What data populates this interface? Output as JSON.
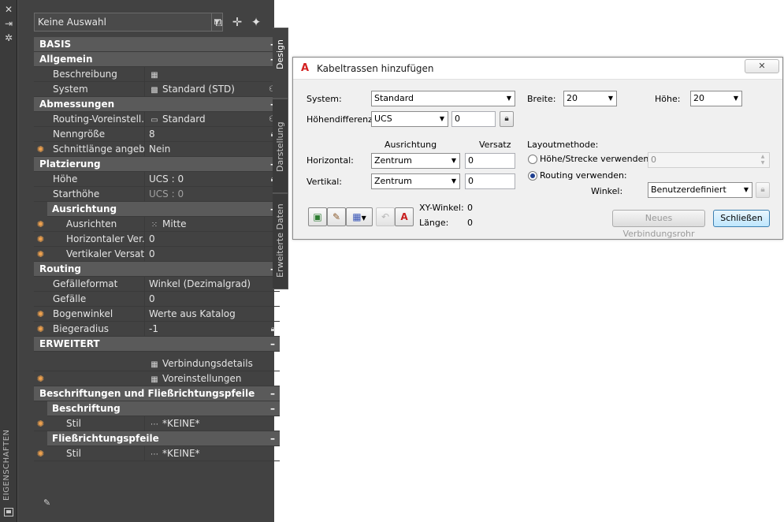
{
  "palette": {
    "title": "EIGENSCHAFTEN",
    "selection": "Keine Auswahl",
    "tabs": [
      "Design",
      "Darstellung",
      "Erweiterte Daten"
    ],
    "sections": [
      {
        "label": "BASIS",
        "toggle": "–"
      },
      {
        "label": "Allgemein",
        "toggle": "–"
      },
      {
        "label": "Abmessungen",
        "toggle": "–"
      },
      {
        "label": "Platzierung",
        "toggle": "–"
      },
      {
        "label": "Ausrichtung",
        "toggle": "–"
      },
      {
        "label": "Routing",
        "toggle": "–"
      },
      {
        "label": "ERWEITERT",
        "toggle": "–"
      },
      {
        "label": "Beschriftungen und Fließrichtungspfeile",
        "toggle": "–"
      },
      {
        "label": "Beschriftung",
        "toggle": "–"
      },
      {
        "label": "Fließrichtungspfeile",
        "toggle": "–"
      }
    ],
    "rows": [
      {
        "name": "Beschreibung",
        "value": ""
      },
      {
        "name": "System",
        "value": "Standard (STD)"
      },
      {
        "name": "Routing-Voreinstell...",
        "value": "Standard"
      },
      {
        "name": "Nenngröße",
        "value": "8"
      },
      {
        "name": "Schnittlänge angeb...",
        "value": "Nein"
      },
      {
        "name": "Höhe",
        "value": "UCS : 0"
      },
      {
        "name": "Starthöhe",
        "value": "UCS : 0"
      },
      {
        "name": "Ausrichten",
        "value": "Mitte"
      },
      {
        "name": "Horizontaler  Ver...",
        "value": "0"
      },
      {
        "name": "Vertikaler Versatz",
        "value": "0"
      },
      {
        "name": "Gefälleformat",
        "value": "Winkel (Dezimalgrad)"
      },
      {
        "name": "Gefälle",
        "value": "0"
      },
      {
        "name": "Bogenwinkel",
        "value": "Werte aus Katalog"
      },
      {
        "name": "Biegeradius",
        "value": "-1"
      },
      {
        "name": "",
        "value": "Verbindungsdetails"
      },
      {
        "name": "",
        "value": "Voreinstellungen"
      },
      {
        "name": "Stil",
        "value": "*KEINE*"
      },
      {
        "name": "Stil",
        "value": "*KEINE*"
      }
    ]
  },
  "dialog": {
    "title": "Kabeltrassen hinzufügen",
    "close": "✕",
    "system_label": "System:",
    "system_value": "Standard",
    "breite_label": "Breite:",
    "breite_value": "20",
    "hoehe_label": "Höhe:",
    "hoehe_value": "20",
    "hoehendiff_label": "Höhendifferenz",
    "hoehendiff_combo": "UCS",
    "hoehendiff_value": "0",
    "col_ausrichtung": "Ausrichtung",
    "col_versatz": "Versatz",
    "horizontal_label": "Horizontal:",
    "horizontal_value": "Zentrum",
    "horizontal_offset": "0",
    "vertikal_label": "Vertikal:",
    "vertikal_value": "Zentrum",
    "vertikal_offset": "0",
    "layout_label": "Layoutmethode:",
    "radio_hoehe": "Höhe/Strecke verwenden:",
    "radio_hoehe_value": "0",
    "radio_routing": "Routing verwenden:",
    "winkel_label": "Winkel:",
    "winkel_value": "Benutzerdefiniert",
    "xy_label": "XY-Winkel:",
    "xy_value": "0",
    "laenge_label": "Länge:",
    "laenge_value": "0",
    "btn_neues": "Neues Verbindungsrohr",
    "btn_schliessen": "Schließen"
  },
  "colors": {
    "palette_bg": "#424242",
    "category_bg": "#5a5a5a",
    "marker": "#f0a24e",
    "dialog_bg": "#f0f0f0",
    "logo": "#d32020"
  }
}
